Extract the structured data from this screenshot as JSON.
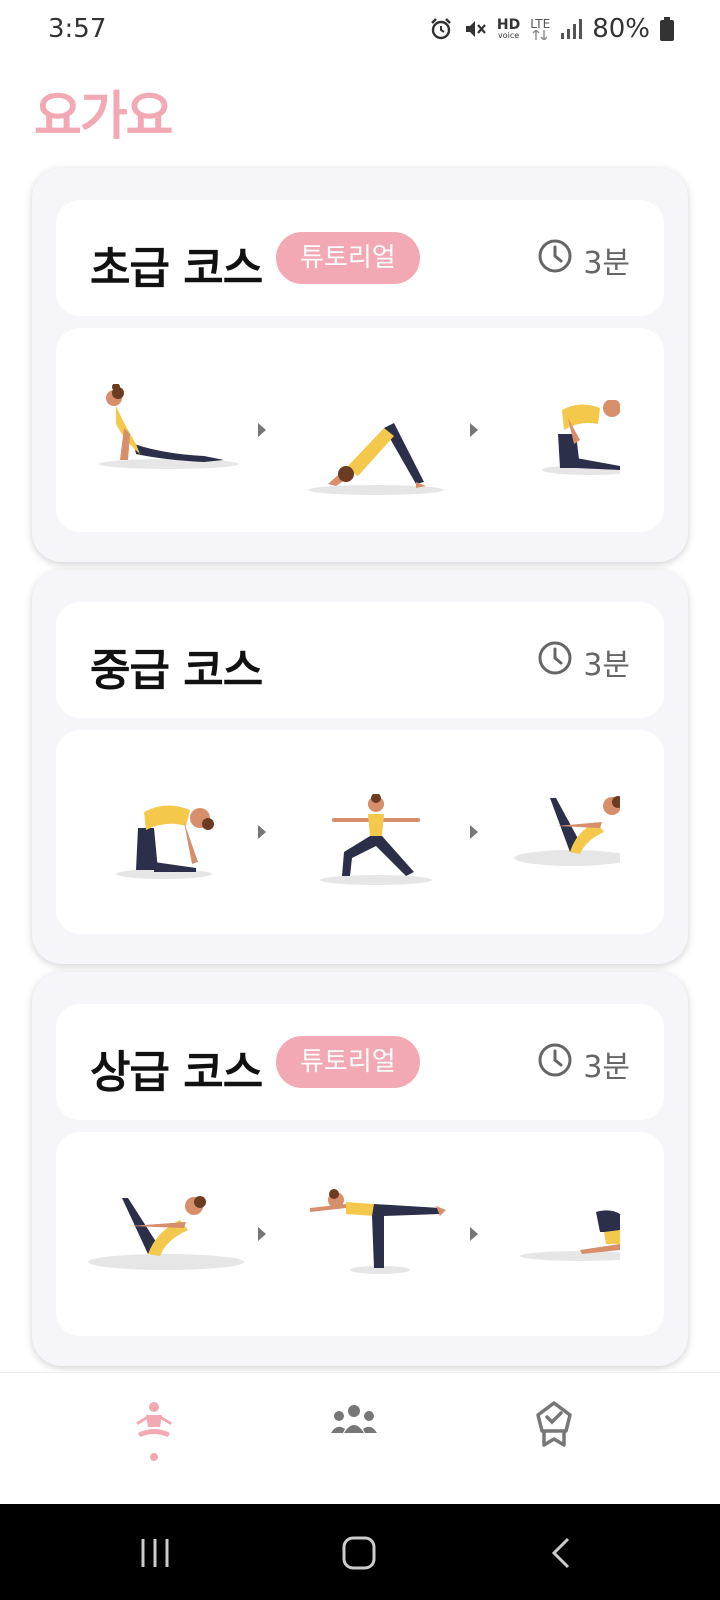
{
  "status_bar": {
    "time": "3:57",
    "battery_percent": "80%",
    "icons": [
      "alarm-icon",
      "mute-icon",
      "hd-voice-icon",
      "lte-icon",
      "signal-icon",
      "battery-icon"
    ],
    "hd_label": "HD",
    "voice_label": "voice",
    "lte_label": "LTE"
  },
  "app": {
    "title": "요가요",
    "accent_color": "#f2a9b3"
  },
  "courses": [
    {
      "title": "초급 코스",
      "badge": "튜토리얼",
      "duration": "3분",
      "poses": [
        "cobra-pose",
        "downward-dog-pose",
        "camel-pose"
      ]
    },
    {
      "title": "중급 코스",
      "badge": "",
      "duration": "3분",
      "poses": [
        "camel-pose",
        "warrior-two-pose",
        "boat-pose"
      ]
    },
    {
      "title": "상급 코스",
      "badge": "튜토리얼",
      "duration": "3분",
      "poses": [
        "boat-pose",
        "warrior-three-pose",
        "plank-pose"
      ]
    }
  ],
  "bottom_nav": {
    "tabs": [
      {
        "icon": "meditation-icon",
        "active": true
      },
      {
        "icon": "community-icon",
        "active": false
      },
      {
        "icon": "badge-icon",
        "active": false
      }
    ]
  },
  "system_nav": [
    "recents-button",
    "home-button",
    "back-button"
  ]
}
